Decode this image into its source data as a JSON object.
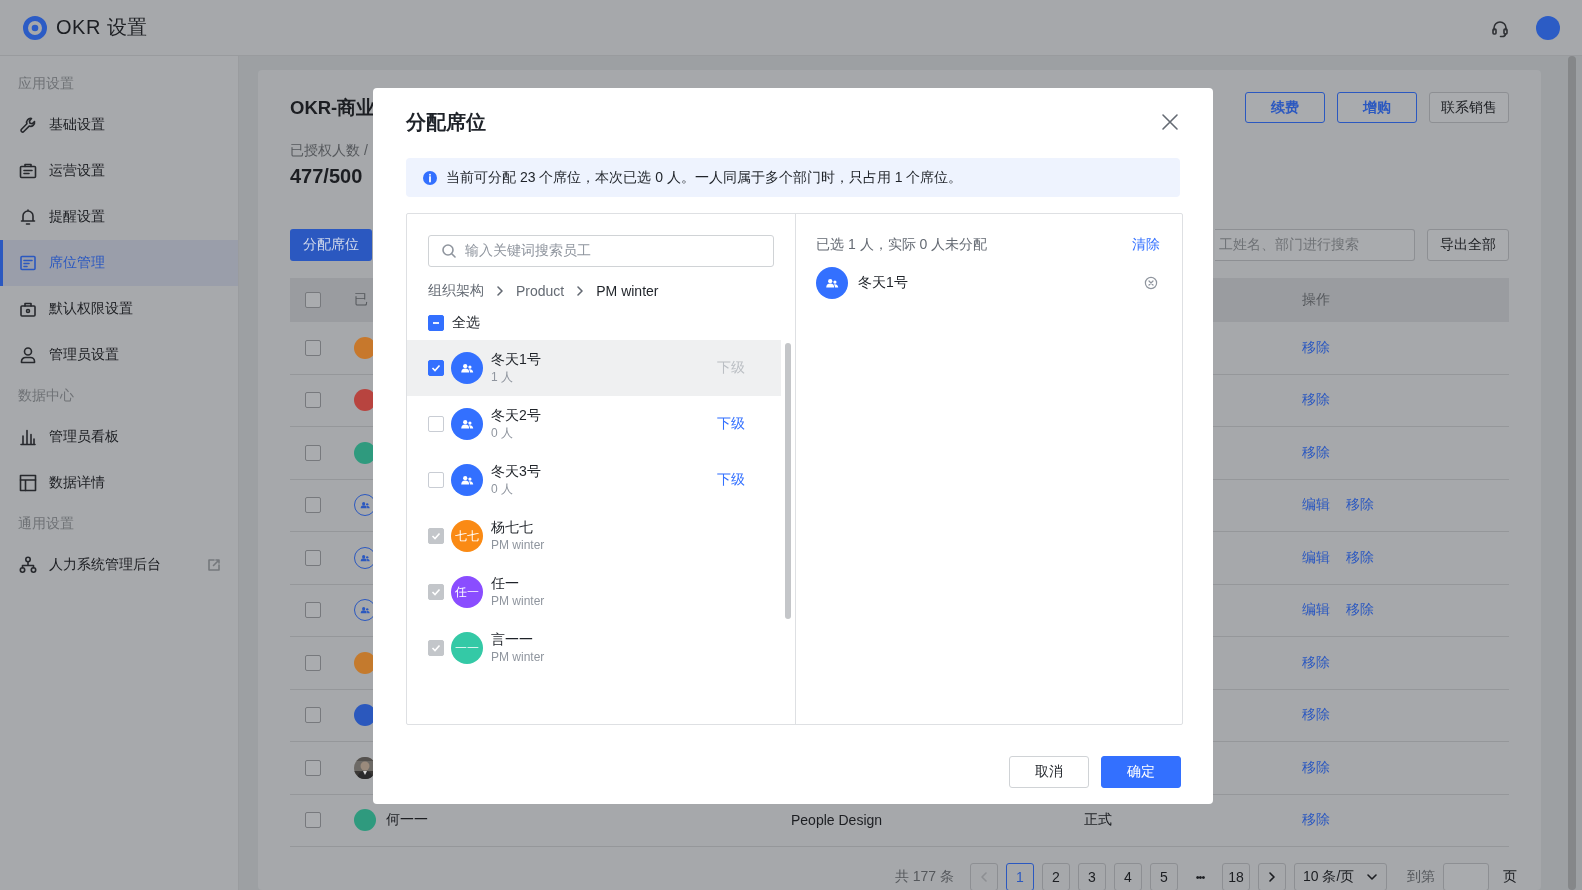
{
  "app": {
    "title": "OKR 设置"
  },
  "sidebar": {
    "sections": [
      {
        "label": "应用设置",
        "items": [
          {
            "label": "基础设置",
            "selected": false
          },
          {
            "label": "运营设置",
            "selected": false
          },
          {
            "label": "提醒设置",
            "selected": false
          },
          {
            "label": "席位管理",
            "selected": true
          },
          {
            "label": "默认权限设置",
            "selected": false
          },
          {
            "label": "管理员设置",
            "selected": false
          }
        ]
      },
      {
        "label": "数据中心",
        "items": [
          {
            "label": "管理员看板",
            "selected": false
          },
          {
            "label": "数据详情",
            "selected": false
          }
        ]
      },
      {
        "label": "通用设置",
        "items": [
          {
            "label": "人力系统管理后台",
            "selected": false,
            "external": true
          }
        ]
      }
    ]
  },
  "page": {
    "title": "OKR-商业",
    "stat_label": "已授权人数 /",
    "stat_value": "477/500",
    "buttons": [
      {
        "label": "续费",
        "kind": "outline"
      },
      {
        "label": "增购",
        "kind": "outline"
      },
      {
        "label": "联系销售",
        "kind": "default"
      }
    ],
    "assign_button": "分配席位",
    "search": {
      "placeholder": "工姓名、部门进行搜索"
    },
    "export_button": "导出全部",
    "table": {
      "columns": [
        "已",
        "操作"
      ],
      "select_all": {
        "checked": false
      },
      "rows": [
        {
          "kind": "initials",
          "checked": false,
          "color": "#c7782c",
          "actions": [
            "移除"
          ]
        },
        {
          "kind": "initials",
          "checked": false,
          "color": "#b8443f",
          "actions": [
            "移除"
          ]
        },
        {
          "kind": "initials",
          "checked": false,
          "color": "#2f9a7e",
          "actions": [
            "移除"
          ]
        },
        {
          "kind": "group",
          "checked": false,
          "actions": [
            "编辑",
            "移除"
          ]
        },
        {
          "kind": "group",
          "checked": false,
          "actions": [
            "编辑",
            "移除"
          ]
        },
        {
          "kind": "group",
          "checked": false,
          "actions": [
            "编辑",
            "移除"
          ]
        },
        {
          "kind": "initials",
          "checked": false,
          "color": "#c47a2d",
          "actions": [
            "移除"
          ]
        },
        {
          "kind": "initials",
          "checked": false,
          "color": "#2b58bd",
          "actions": [
            "移除"
          ]
        },
        {
          "checked": false,
          "actions": [
            "移除"
          ]
        },
        {
          "kind": "initials",
          "checked": false,
          "color": "#2f9a7e",
          "name": "何一一",
          "dept": "People Design",
          "status": "正式",
          "actions": [
            "移除"
          ]
        }
      ]
    },
    "pagination": {
      "total": "共 177 条",
      "pages": [
        {
          "kind": "page",
          "label": "1",
          "selected": true
        },
        {
          "kind": "page",
          "label": "2",
          "selected": false
        },
        {
          "kind": "page",
          "label": "3",
          "selected": false
        },
        {
          "kind": "page",
          "label": "4",
          "selected": false
        },
        {
          "kind": "page",
          "label": "5",
          "selected": false
        },
        {
          "kind": "ellipsis",
          "label": "•••"
        },
        {
          "kind": "page",
          "label": "18",
          "selected": false
        }
      ],
      "page_size": "10 条/页",
      "jump_label": "到第",
      "jump_suffix": "页"
    }
  },
  "modal": {
    "title": "分配席位",
    "notice": "当前可分配 23 个席位，本次已选 0 人。一人同属于多个部门时，只占用 1 个席位。",
    "search": {
      "placeholder": "输入关键词搜索员工"
    },
    "breadcrumb": [
      {
        "label": "组织架构",
        "selected": false
      },
      {
        "label": "Product",
        "selected": false
      },
      {
        "label": "PM winter",
        "selected": true
      }
    ],
    "select_all": {
      "label": "全选",
      "indeterminate": true
    },
    "items": [
      {
        "kind": "group",
        "name": "冬天1号",
        "sub": "1 人",
        "checked": true,
        "disabled": false,
        "selected": true,
        "link": "下级",
        "link_disabled": true
      },
      {
        "kind": "group",
        "name": "冬天2号",
        "sub": "0 人",
        "checked": false,
        "disabled": false,
        "selected": false,
        "link": "下级",
        "link_disabled": false
      },
      {
        "kind": "group",
        "name": "冬天3号",
        "sub": "0 人",
        "checked": false,
        "disabled": false,
        "selected": false,
        "link": "下级",
        "link_disabled": false
      },
      {
        "kind": "person",
        "name": "杨七七",
        "sub": "PM winter",
        "initials": "七七",
        "color": "#fa8a14",
        "checked": true,
        "disabled": true,
        "selected": false
      },
      {
        "kind": "person",
        "name": "任一",
        "sub": "PM winter",
        "initials": "任一",
        "color": "#8a4dff",
        "checked": true,
        "disabled": true,
        "selected": false
      },
      {
        "kind": "person",
        "name": "言一一",
        "sub": "PM winter",
        "initials": "一一",
        "color": "#34c9a6",
        "checked": true,
        "disabled": true,
        "selected": false
      }
    ],
    "summary": "已选 1 人，实际 0 人未分配",
    "clear": "清除",
    "chosen": [
      {
        "kind": "group",
        "name": "冬天1号"
      }
    ],
    "buttons": [
      {
        "label": "取消",
        "kind": "default"
      },
      {
        "label": "确定",
        "kind": "primary"
      }
    ]
  }
}
